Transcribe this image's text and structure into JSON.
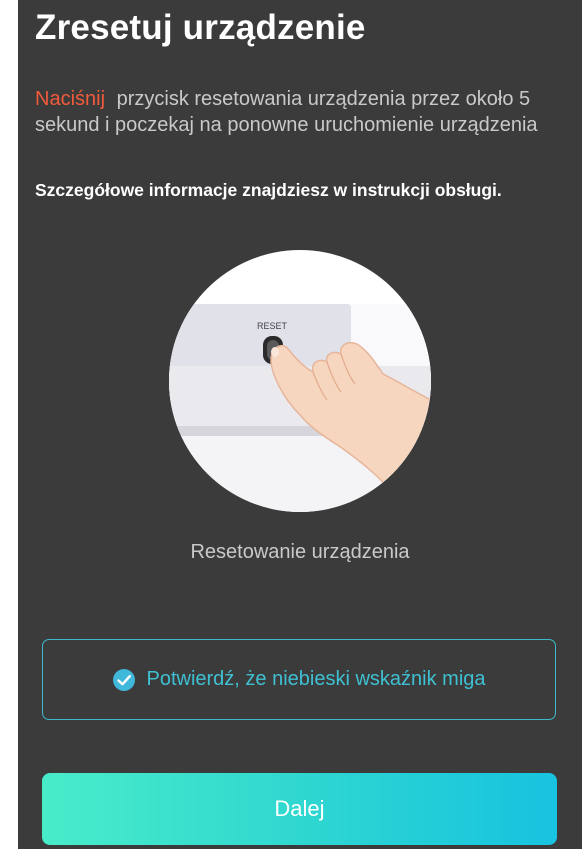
{
  "header": {
    "title": "Zresetuj urządzenie"
  },
  "instruction": {
    "highlight": "Naciśnij",
    "text": "przycisk resetowania urządzenia przez około 5 sekund i poczekaj na ponowne uruchomienie urządzenia"
  },
  "details": "Szczegółowe informacje znajdziesz w instrukcji obsługi.",
  "illustration": {
    "button_label": "RESET"
  },
  "caption": "Resetowanie urządzenia",
  "confirm": {
    "label": "Potwierdź, że niebieski wskaźnik miga",
    "checked": true,
    "icon": "check-circle-icon"
  },
  "next_button": {
    "label": "Dalej"
  },
  "colors": {
    "background": "#3b3b3b",
    "highlight": "#f25a3c",
    "accent": "#3fc0d2",
    "button_gradient_start": "#49ecc9",
    "button_gradient_end": "#17c3e0"
  }
}
